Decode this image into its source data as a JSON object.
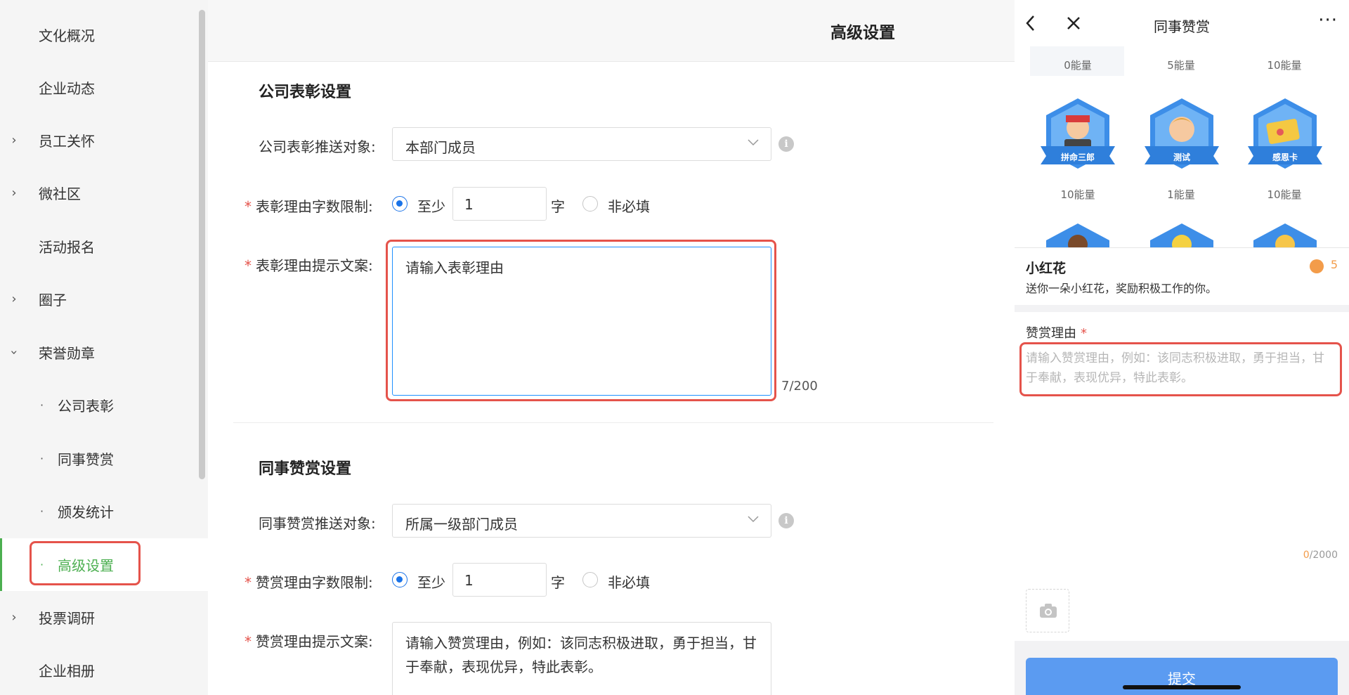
{
  "sidebar": {
    "items": [
      {
        "label": "文化概况",
        "expandable": false
      },
      {
        "label": "企业动态",
        "expandable": false
      },
      {
        "label": "员工关怀",
        "expandable": true,
        "expanded": false
      },
      {
        "label": "微社区",
        "expandable": true,
        "expanded": false
      },
      {
        "label": "活动报名",
        "expandable": false
      },
      {
        "label": "圈子",
        "expandable": true,
        "expanded": false
      },
      {
        "label": "荣誉勋章",
        "expandable": true,
        "expanded": true
      },
      {
        "label": "公司表彰",
        "sub": true
      },
      {
        "label": "同事赞赏",
        "sub": true
      },
      {
        "label": "颁发统计",
        "sub": true
      },
      {
        "label": "高级设置",
        "sub": true,
        "active": true
      },
      {
        "label": "投票调研",
        "expandable": true,
        "expanded": false
      },
      {
        "label": "企业相册",
        "expandable": false
      }
    ],
    "sub_bullet": "·"
  },
  "main": {
    "header_title": "高级设置",
    "company": {
      "title": "公司表彰设置",
      "push_label": "公司表彰推送对象:",
      "push_value": "本部门成员",
      "limit_label": "表彰理由字数限制:",
      "radio_min_label": "至少",
      "min_value": "1",
      "unit": "字",
      "radio_optional_label": "非必填",
      "prompt_label": "表彰理由提示文案:",
      "prompt_value": "请输入表彰理由",
      "counter": "7/200"
    },
    "peer": {
      "title": "同事赞赏设置",
      "push_label": "同事赞赏推送对象:",
      "push_value": "所属一级部门成员",
      "limit_label": "赞赏理由字数限制:",
      "radio_min_label": "至少",
      "min_value": "1",
      "unit": "字",
      "radio_optional_label": "非必填",
      "prompt_label": "赞赏理由提示文案:",
      "prompt_value": "请输入赞赏理由，例如：该同志积极进取，勇于担当，甘于奉献，表现优异，特此表彰。"
    },
    "required_mark": "*",
    "info_glyph": "i"
  },
  "phone": {
    "title": "同事赞赏",
    "more": "···",
    "energy_top": [
      "0能量",
      "5能量",
      "10能量"
    ],
    "badges": [
      {
        "caption": "拼命三郎",
        "energy": "10能量"
      },
      {
        "caption": "测试",
        "energy": "1能量"
      },
      {
        "caption": "感恩卡",
        "energy": "10能量"
      }
    ],
    "selected": {
      "name": "小红花",
      "desc": "送你一朵小红花，奖励积极工作的你。",
      "points": "5"
    },
    "reason_label": "赞赏理由",
    "reason_placeholder": "请输入赞赏理由，例如：该同志积极进取，勇于担当，甘于奉献，表现优异，特此表彰。",
    "count_current": "0",
    "count_max": "/2000",
    "submit_label": "提交"
  },
  "colors": {
    "active": "#4caf50",
    "highlight": "#e5534b",
    "primary": "#1a73e8",
    "submit": "#5b9bf1",
    "coin": "#f39c4a",
    "badge_blue": "#3d8ee8"
  }
}
